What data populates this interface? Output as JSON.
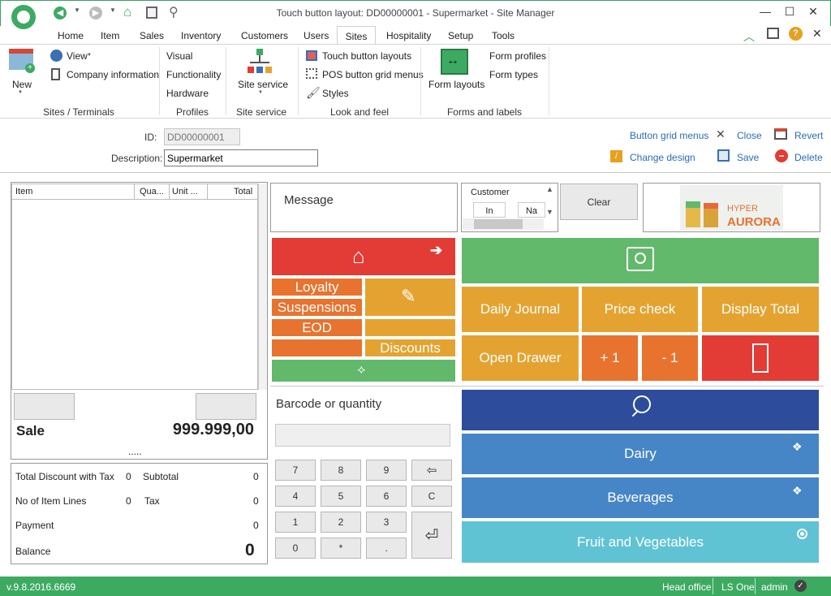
{
  "window": {
    "title": "Touch button layout: DD00000001 - Supermarket - Site Manager"
  },
  "menu": [
    "Home",
    "Item",
    "Sales",
    "Inventory",
    "Customers",
    "Users",
    "Sites",
    "Hospitality",
    "Setup",
    "Tools"
  ],
  "ribbon": {
    "new": "New",
    "view": "View",
    "company_info": "Company information",
    "visual": "Visual",
    "functionality": "Functionality",
    "hardware": "Hardware",
    "site_service": "Site service",
    "touch_button_layouts": "Touch button layouts",
    "pos_button_grid_menus": "POS button grid menus",
    "styles": "Styles",
    "form_layouts": "Form layouts",
    "form_profiles": "Form profiles",
    "form_types": "Form types",
    "groups": {
      "sites_terminals": "Sites / Terminals",
      "profiles": "Profiles",
      "site_service": "Site service",
      "look_and_feel": "Look and feel",
      "forms_and_labels": "Forms and labels"
    }
  },
  "form": {
    "id_label": "ID:",
    "id_value": "DD00000001",
    "desc_label": "Description:",
    "desc_value": "Supermarket"
  },
  "actions": {
    "button_grid_menus": "Button grid menus",
    "close": "Close",
    "revert": "Revert",
    "change_design": "Change design",
    "save": "Save",
    "delete": "Delete"
  },
  "receipt": {
    "columns": [
      "Item",
      "Qua...",
      "Unit ...",
      "Total"
    ],
    "sale_label": "Sale",
    "sale_total": "999.999,00",
    "dots": ".....",
    "total_discount_label": "Total Discount with Tax",
    "total_discount_value": "0",
    "subtotal_label": "Subtotal",
    "subtotal_value": "0",
    "lines_label": "No of Item Lines",
    "lines_value": "0",
    "tax_label": "Tax",
    "tax_value": "0",
    "payment_label": "Payment",
    "payment_value": "0",
    "balance_label": "Balance",
    "balance_value": "0"
  },
  "message": {
    "label": "Message"
  },
  "customer": {
    "label": "Customer",
    "col1": "In",
    "col2": "Na",
    "clear": "Clear"
  },
  "logo": {
    "line1": "HYPER",
    "line2": "AURORA"
  },
  "buttons": {
    "loyalty": "Loyalty",
    "suspensions": "Suspensions",
    "eod": "EOD",
    "discounts": "Discounts",
    "daily_journal": "Daily Journal",
    "price_check": "Price check",
    "display_total": "Display Total",
    "open_drawer": "Open Drawer",
    "plus_one": "+ 1",
    "minus_one": "- 1"
  },
  "numpad": {
    "label": "Barcode or quantity",
    "keys": [
      "7",
      "8",
      "9",
      "4",
      "5",
      "6",
      "C",
      "1",
      "2",
      "3",
      "0",
      "*",
      "."
    ]
  },
  "categories": [
    "Dairy",
    "Beverages",
    "Fruit and Vegetables"
  ],
  "status": {
    "version": "v.9.8.2016.6669",
    "office": "Head office",
    "product": "LS One",
    "user": "admin"
  },
  "colors": {
    "accent": "#3daa62",
    "red": "#e33b35",
    "green": "#62b96b",
    "orange": "#e7732f",
    "amber": "#e4a331",
    "navy": "#2e4c9c",
    "blue": "#4686c7",
    "teal": "#5fc3d4"
  }
}
